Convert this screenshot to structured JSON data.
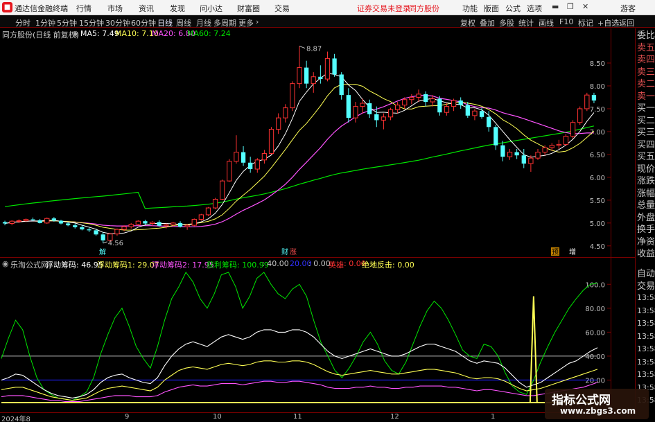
{
  "window": {
    "app_name": "通达信金融终端",
    "menu": [
      "行情",
      "市场",
      "资讯",
      "发现",
      "问小达",
      "财富圈",
      "交易"
    ],
    "warning": "证券交易未登录",
    "stock_name": "同方股份",
    "right_menu": [
      "功能",
      "版面",
      "公式",
      "选项"
    ],
    "user": "游客",
    "window_buttons": [
      "▬",
      "❐",
      "✕"
    ]
  },
  "toolbar": {
    "periods": [
      "分时",
      "1分钟",
      "5分钟",
      "15分钟",
      "30分钟",
      "60分钟",
      "日线",
      "周线",
      "月线",
      "多周期",
      "更多"
    ],
    "selected_period": "日线",
    "right_buttons": [
      "复权",
      "叠加",
      "多股",
      "统计",
      "画线",
      "F10",
      "标记",
      "+自选",
      "返回"
    ]
  },
  "main_info": {
    "title": "同方股份(日线 前复权)",
    "ma5_label": "MA5: 7.49",
    "ma10_label": "MA10: 7.10",
    "ma20_label": "MA20: 6.80",
    "ma60_label": "MA60: 7.24"
  },
  "sub_info": {
    "formula": "乐淘公式网",
    "fudong": "浮动筹码: 46.95",
    "fudong1": "浮动筹码1: 29.07",
    "fudong2": "浮动筹码2: 17.95",
    "huoli": "获利筹码: 100.99",
    "v40": ": 40.00",
    "v20": "20.00",
    "v0": ": 0.00",
    "yingxiong": "英雄",
    "yingxiong_val": ": 0.00",
    "juedi": "绝地反击: 0.00"
  },
  "markers": {
    "high_label": "8.87",
    "low_label": "4.56",
    "cai": "财",
    "zhang": "涨",
    "jie": "解",
    "tuo": "预",
    "zeng": "增"
  },
  "price_axis": [
    "8.50",
    "8.00",
    "7.50",
    "7.00",
    "6.50",
    "6.00",
    "5.50",
    "5.00",
    "4.50"
  ],
  "sub_axis": [
    "100.0",
    "80.00",
    "60.00",
    "40.00",
    "20.00"
  ],
  "x_axis": [
    "2024年8",
    "9",
    "10",
    "11",
    "12",
    "1"
  ],
  "right_panel": {
    "top_labels": [
      "委比",
      "卖五",
      "卖四",
      "卖三",
      "卖二",
      "卖一",
      "买一",
      "买二",
      "买三",
      "买四",
      "买五",
      "现价",
      "涨跌",
      "涨幅",
      "总量",
      "外盘",
      "换手",
      "净资",
      "收益"
    ],
    "trade_labels": [
      "自动",
      "交易"
    ],
    "times": [
      "13:58",
      "13:58",
      "13:58",
      "13:58",
      "13:58",
      "13:58",
      "13:58",
      "13:58",
      "13:58"
    ]
  },
  "watermark": {
    "line1": "指标公式网",
    "line2": "www.zbgs3.com"
  },
  "colors": {
    "up": "#ff3232",
    "down": "#54ffff",
    "ma5": "#ffffff",
    "ma10": "#ffff54",
    "ma20": "#ff54ff",
    "ma60": "#00e600",
    "grid": "#7a0000"
  },
  "chart_data": [
    {
      "type": "candlestick",
      "title": "同方股份(日线 前复权)",
      "ylim": [
        4.3,
        9.0
      ],
      "candles": [
        [
          5.02,
          5.05,
          4.95,
          4.99
        ],
        [
          4.99,
          5.06,
          4.95,
          5.04
        ],
        [
          5.04,
          5.08,
          5.0,
          5.05
        ],
        [
          5.05,
          5.1,
          5.02,
          5.08
        ],
        [
          5.08,
          5.12,
          5.04,
          5.06
        ],
        [
          5.06,
          5.09,
          4.99,
          5.0
        ],
        [
          5.0,
          5.12,
          4.98,
          5.1
        ],
        [
          5.1,
          5.13,
          5.03,
          5.05
        ],
        [
          5.05,
          5.07,
          4.97,
          4.99
        ],
        [
          4.99,
          5.02,
          4.93,
          4.95
        ],
        [
          4.95,
          4.99,
          4.88,
          4.91
        ],
        [
          4.91,
          4.95,
          4.84,
          4.86
        ],
        [
          4.86,
          4.9,
          4.8,
          4.84
        ],
        [
          4.84,
          4.88,
          4.72,
          4.75
        ],
        [
          4.75,
          4.8,
          4.56,
          4.62
        ],
        [
          4.62,
          4.78,
          4.58,
          4.76
        ],
        [
          4.76,
          4.88,
          4.72,
          4.86
        ],
        [
          4.86,
          4.95,
          4.82,
          4.92
        ],
        [
          4.92,
          5.0,
          4.88,
          4.97
        ],
        [
          4.97,
          5.06,
          4.94,
          5.04
        ],
        [
          5.04,
          5.07,
          4.96,
          4.99
        ],
        [
          4.99,
          5.04,
          4.94,
          5.02
        ],
        [
          5.02,
          5.06,
          4.92,
          4.94
        ],
        [
          4.94,
          4.99,
          4.88,
          4.96
        ],
        [
          4.96,
          5.02,
          4.92,
          5.0
        ],
        [
          5.0,
          5.04,
          4.9,
          4.92
        ],
        [
          4.92,
          4.98,
          4.85,
          4.95
        ],
        [
          4.95,
          5.1,
          4.93,
          5.08
        ],
        [
          5.08,
          5.2,
          5.05,
          5.18
        ],
        [
          5.18,
          5.35,
          5.15,
          5.33
        ],
        [
          5.33,
          5.55,
          5.3,
          5.52
        ],
        [
          5.52,
          5.95,
          5.5,
          5.92
        ],
        [
          5.92,
          6.4,
          5.9,
          6.35
        ],
        [
          6.35,
          6.92,
          6.3,
          6.55
        ],
        [
          6.55,
          6.68,
          6.25,
          6.32
        ],
        [
          6.32,
          6.45,
          6.1,
          6.18
        ],
        [
          6.18,
          6.42,
          6.1,
          6.38
        ],
        [
          6.38,
          6.6,
          6.3,
          6.52
        ],
        [
          6.52,
          7.1,
          6.5,
          7.05
        ],
        [
          7.05,
          7.4,
          6.95,
          7.3
        ],
        [
          7.3,
          7.6,
          7.2,
          7.52
        ],
        [
          7.52,
          8.1,
          7.45,
          8.05
        ],
        [
          8.05,
          8.87,
          7.95,
          8.4
        ],
        [
          8.4,
          8.55,
          7.95,
          8.05
        ],
        [
          8.05,
          8.3,
          7.85,
          8.2
        ],
        [
          8.2,
          8.45,
          8.05,
          8.15
        ],
        [
          8.15,
          8.75,
          8.1,
          8.6
        ],
        [
          8.6,
          8.7,
          8.2,
          8.25
        ],
        [
          8.25,
          8.3,
          7.7,
          7.8
        ],
        [
          7.8,
          7.95,
          7.2,
          7.3
        ],
        [
          7.3,
          7.65,
          7.2,
          7.55
        ],
        [
          7.55,
          7.72,
          7.4,
          7.62
        ],
        [
          7.62,
          7.7,
          7.3,
          7.38
        ],
        [
          7.38,
          7.55,
          7.1,
          7.25
        ],
        [
          7.25,
          7.4,
          7.05,
          7.32
        ],
        [
          7.32,
          7.52,
          7.25,
          7.48
        ],
        [
          7.48,
          7.65,
          7.4,
          7.58
        ],
        [
          7.58,
          7.75,
          7.5,
          7.7
        ],
        [
          7.7,
          7.82,
          7.6,
          7.75
        ],
        [
          7.75,
          7.92,
          7.65,
          7.82
        ],
        [
          7.82,
          7.88,
          7.55,
          7.65
        ],
        [
          7.65,
          7.8,
          7.55,
          7.72
        ],
        [
          7.72,
          7.78,
          7.35,
          7.42
        ],
        [
          7.42,
          7.62,
          7.35,
          7.55
        ],
        [
          7.55,
          7.72,
          7.45,
          7.68
        ],
        [
          7.68,
          7.75,
          7.5,
          7.58
        ],
        [
          7.58,
          7.65,
          7.3,
          7.35
        ],
        [
          7.35,
          7.5,
          7.25,
          7.45
        ],
        [
          7.45,
          7.52,
          7.28,
          7.32
        ],
        [
          7.32,
          7.45,
          7.0,
          7.1
        ],
        [
          7.1,
          7.15,
          6.6,
          6.7
        ],
        [
          6.7,
          6.8,
          6.35,
          6.45
        ],
        [
          6.45,
          6.62,
          6.38,
          6.55
        ],
        [
          6.55,
          6.62,
          6.4,
          6.48
        ],
        [
          6.48,
          6.62,
          6.2,
          6.3
        ],
        [
          6.3,
          6.48,
          6.12,
          6.42
        ],
        [
          6.42,
          6.62,
          6.38,
          6.55
        ],
        [
          6.55,
          6.7,
          6.48,
          6.65
        ],
        [
          6.65,
          6.75,
          6.58,
          6.7
        ],
        [
          6.7,
          6.82,
          6.62,
          6.72
        ],
        [
          6.72,
          6.95,
          6.68,
          6.9
        ],
        [
          6.9,
          7.25,
          6.85,
          7.2
        ],
        [
          7.2,
          7.55,
          7.15,
          7.5
        ],
        [
          7.5,
          7.85,
          7.45,
          7.8
        ],
        [
          7.8,
          7.85,
          7.62,
          7.68
        ]
      ],
      "ma60_start": 5.45,
      "ma60_end": 7.24
    },
    {
      "type": "line",
      "title": "乐淘公式网",
      "ylim": [
        0,
        110
      ],
      "series": [
        {
          "name": "获利筹码",
          "color": "#00e600",
          "values": [
            38,
            55,
            70,
            62,
            40,
            22,
            12,
            8,
            5,
            4,
            3,
            6,
            10,
            22,
            42,
            58,
            72,
            80,
            65,
            48,
            38,
            30,
            48,
            70,
            88,
            98,
            110,
            102,
            88,
            80,
            92,
            108,
            110,
            98,
            80,
            90,
            105,
            110,
            100,
            92,
            88,
            96,
            100,
            90,
            70,
            52,
            40,
            28,
            22,
            30,
            40,
            52,
            60,
            50,
            36,
            28,
            25,
            35,
            50,
            65,
            78,
            86,
            80,
            70,
            58,
            45,
            40,
            38,
            50,
            48,
            40,
            26,
            15,
            10,
            8,
            20,
            35,
            48,
            60,
            70,
            80,
            88,
            95,
            100,
            101
          ]
        },
        {
          "name": "浮动筹码",
          "color": "#ffffff",
          "values": [
            20,
            22,
            25,
            24,
            20,
            16,
            12,
            9,
            7,
            6,
            5,
            6,
            8,
            12,
            18,
            22,
            24,
            25,
            22,
            20,
            18,
            17,
            22,
            32,
            40,
            46,
            50,
            52,
            50,
            48,
            52,
            56,
            58,
            56,
            54,
            56,
            60,
            62,
            62,
            60,
            60,
            62,
            62,
            60,
            56,
            50,
            44,
            40,
            38,
            40,
            42,
            44,
            46,
            44,
            42,
            40,
            40,
            42,
            45,
            48,
            50,
            50,
            48,
            46,
            44,
            40,
            36,
            34,
            36,
            35,
            34,
            30,
            24,
            18,
            14,
            16,
            18,
            22,
            26,
            30,
            34,
            36,
            40,
            44,
            47
          ]
        },
        {
          "name": "浮动筹码1",
          "color": "#ffff54",
          "values": [
            12,
            13,
            14,
            14,
            12,
            10,
            8,
            6,
            5,
            4,
            3,
            4,
            5,
            8,
            11,
            13,
            14,
            15,
            14,
            13,
            12,
            11,
            14,
            20,
            24,
            28,
            30,
            31,
            30,
            29,
            31,
            33,
            34,
            33,
            32,
            33,
            35,
            36,
            36,
            35,
            35,
            36,
            36,
            35,
            33,
            30,
            27,
            25,
            24,
            25,
            26,
            27,
            28,
            27,
            26,
            25,
            25,
            26,
            27,
            28,
            29,
            29,
            28,
            27,
            26,
            24,
            22,
            21,
            22,
            22,
            21,
            19,
            16,
            13,
            11,
            12,
            13,
            15,
            17,
            19,
            21,
            23,
            25,
            27,
            29
          ]
        },
        {
          "name": "浮动筹码2",
          "color": "#ff54ff",
          "values": [
            6,
            7,
            7,
            7,
            6,
            5,
            4,
            3,
            3,
            2,
            2,
            2,
            3,
            4,
            5,
            6,
            7,
            7,
            7,
            6,
            6,
            6,
            7,
            10,
            12,
            14,
            15,
            16,
            15,
            15,
            16,
            17,
            17,
            17,
            16,
            17,
            18,
            19,
            19,
            18,
            18,
            19,
            19,
            18,
            17,
            16,
            14,
            13,
            13,
            13,
            14,
            14,
            15,
            14,
            14,
            13,
            13,
            14,
            14,
            15,
            15,
            15,
            15,
            14,
            14,
            13,
            12,
            11,
            12,
            12,
            11,
            10,
            9,
            8,
            7,
            7,
            8,
            9,
            10,
            11,
            12,
            13,
            14,
            16,
            18
          ]
        },
        {
          "name": "绝地反击",
          "color": "#ffff54",
          "spike_index": 75,
          "spike_value": 90
        }
      ]
    }
  ]
}
